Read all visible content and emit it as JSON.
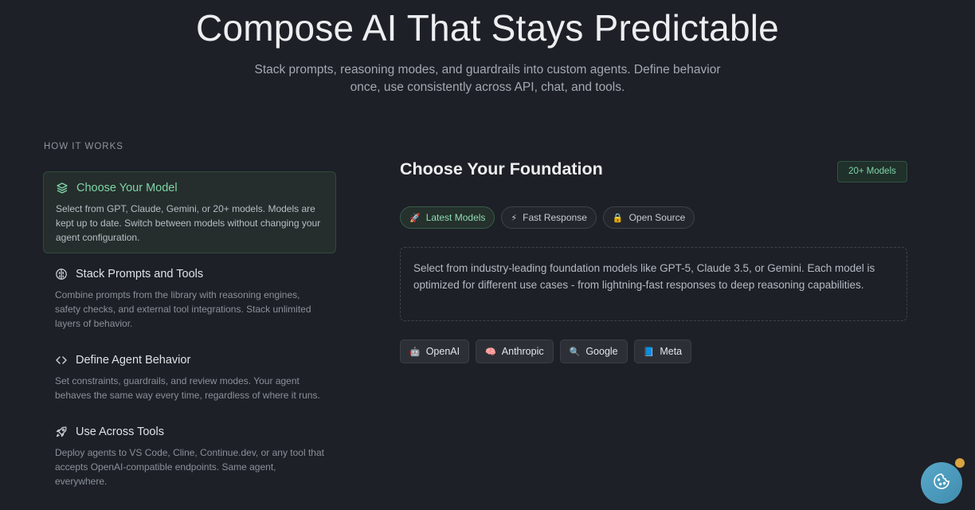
{
  "hero": {
    "title": "Compose AI That Stays Predictable",
    "subtitle": "Stack prompts, reasoning modes, and guardrails into custom agents. Define behavior once, use consistently across API, chat, and tools."
  },
  "how_it_works": {
    "label": "HOW IT WORKS",
    "steps": [
      {
        "title": "Choose Your Model",
        "desc": "Select from GPT, Claude, Gemini, or 20+ models. Models are kept up to date. Switch between models without changing your agent configuration.",
        "icon": "layers-icon",
        "active": true
      },
      {
        "title": "Stack Prompts and Tools",
        "desc": "Combine prompts from the library with reasoning engines, safety checks, and external tool integrations. Stack unlimited layers of behavior.",
        "icon": "brain-icon",
        "active": false
      },
      {
        "title": "Define Agent Behavior",
        "desc": "Set constraints, guardrails, and review modes. Your agent behaves the same way every time, regardless of where it runs.",
        "icon": "code-icon",
        "active": false
      },
      {
        "title": "Use Across Tools",
        "desc": "Deploy agents to VS Code, Cline, Continue.dev, or any tool that accepts OpenAI-compatible endpoints. Same agent, everywhere.",
        "icon": "rocket-icon",
        "active": false
      }
    ]
  },
  "panel": {
    "title": "Choose Your Foundation",
    "badge": "20+ Models",
    "filters": [
      {
        "label": "Latest Models",
        "icon": "🚀",
        "active": true
      },
      {
        "label": "Fast Response",
        "icon": "⚡",
        "active": false
      },
      {
        "label": "Open Source",
        "icon": "🔒",
        "active": false
      }
    ],
    "description": "Select from industry-leading foundation models like GPT-5, Claude 3.5, or Gemini. Each model is optimized for different use cases - from lightning-fast responses to deep reasoning capabilities.",
    "providers": [
      {
        "label": "OpenAI",
        "icon": "🤖"
      },
      {
        "label": "Anthropic",
        "icon": "🧠"
      },
      {
        "label": "Google",
        "icon": "🔍"
      },
      {
        "label": "Meta",
        "icon": "📘"
      }
    ]
  },
  "colors": {
    "background": "#1d2026",
    "accent": "#7fd4a8",
    "cookie_button": "#4f9fc2",
    "notification_dot": "#d9a441"
  }
}
